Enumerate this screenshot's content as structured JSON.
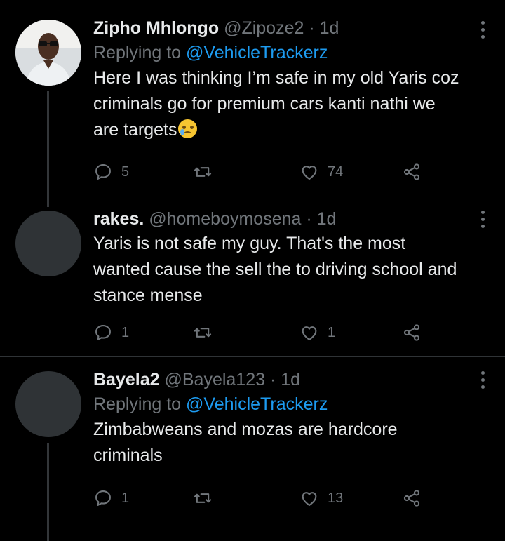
{
  "tweets": [
    {
      "name": "Zipho Mhlongo",
      "handle": "@Zipoze2",
      "time": "· 1d",
      "replying_prefix": "Replying to",
      "replying_handle": "@VehicleTrackerz",
      "text": "Here I was thinking I’m safe in my old Yaris coz criminals go for premium cars kanti nathi we are targets",
      "text_emoji": "crying-face-emoji",
      "replies": "5",
      "retweets": "",
      "likes": "74"
    },
    {
      "name": "rakes.",
      "handle": "@homeboymosena",
      "time": "· 1d",
      "text": "Yaris is not safe my guy. That's the most wanted cause the sell the to driving school and stance mense",
      "replies": "1",
      "retweets": "",
      "likes": "1"
    },
    {
      "name": "Bayela2",
      "handle": "@Bayela123",
      "time": "· 1d",
      "replying_prefix": "Replying to",
      "replying_handle": "@VehicleTrackerz",
      "text": "Zimbabweans and mozas are hardcore criminals",
      "replies": "1",
      "retweets": "",
      "likes": "13"
    }
  ],
  "icons": {
    "reply": "speech-bubble-icon",
    "retweet": "retweet-arrows-icon",
    "like": "heart-icon",
    "share": "share-nodes-icon",
    "more": "vertical-dots-icon"
  },
  "colors": {
    "background": "#000000",
    "text": "#e7e9ea",
    "muted": "#71767b",
    "link": "#1d9bf0",
    "divider": "#2f3336"
  }
}
